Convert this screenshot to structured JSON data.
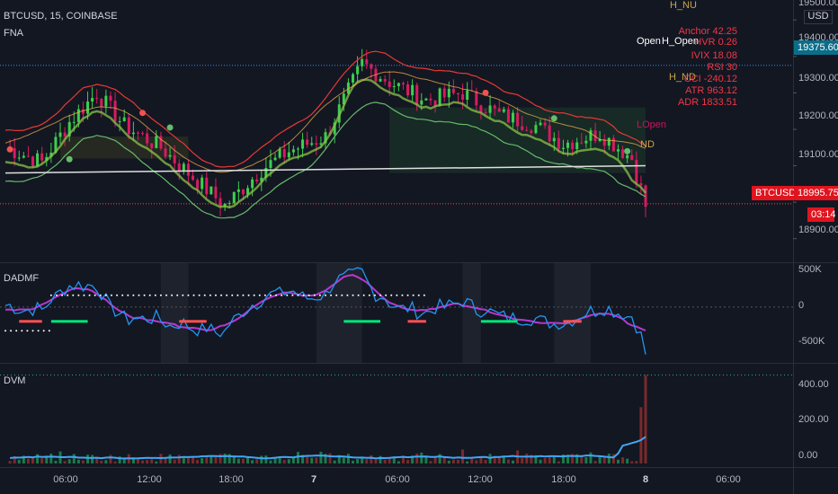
{
  "symbol_title": "BTCUSD, 15, COINBASE",
  "main_indicator": "FNA",
  "currency": "USD",
  "price_axis": [
    "19500.00",
    "19400.00",
    "19300.00",
    "19200.00",
    "19100.00",
    "19000.00",
    "18900.00"
  ],
  "price_tags": {
    "open_price": "19375.60",
    "last_symbol": "BTCUSD",
    "last_price": "18995.75",
    "countdown": "03:14"
  },
  "chart_labels": {
    "h_nu": "H_NU",
    "open": "Open",
    "h_open": "H_Open",
    "h_nd": "H_ND",
    "l_open": "LOpen",
    "nd": "ND"
  },
  "stats": [
    "Anchor 42.25",
    "HVR 0.26",
    "IVIX 18.08",
    "RSI 30",
    "CCI -240.12",
    "ATR 963.12",
    "ADR 1833.51"
  ],
  "dadmf": {
    "title": "DADMF",
    "axis": [
      "500K",
      "0",
      "-500K"
    ]
  },
  "dvm": {
    "title": "DVM",
    "axis": [
      "400.00",
      "200.00",
      "0.00"
    ]
  },
  "time_axis": [
    "06:00",
    "12:00",
    "18:00",
    "7",
    "06:00",
    "12:00",
    "18:00",
    "8",
    "06:00"
  ],
  "colors": {
    "background": "#131722",
    "up": "#26a69a",
    "down": "#ef5350",
    "band_red": "#e53935",
    "band_green": "#66bb6a",
    "dadmf_blue": "#2196f3",
    "dadmf_magenta": "#e040fb"
  },
  "chart_data": {
    "type": "candlestick",
    "title": "BTCUSD, 15, COINBASE",
    "y_range": [
      18850,
      19540
    ],
    "y_ticks": [
      19500,
      19400,
      19300,
      19200,
      19100,
      19000,
      18900
    ],
    "x_ticks": [
      "06:00",
      "12:00",
      "18:00",
      "7",
      "06:00",
      "12:00",
      "18:00",
      "8",
      "06:00"
    ],
    "price_anchor": [
      [
        0,
        19150
      ],
      [
        8,
        19110
      ],
      [
        14,
        19220
      ],
      [
        20,
        19300
      ],
      [
        26,
        19210
      ],
      [
        34,
        19150
      ],
      [
        40,
        19080
      ],
      [
        48,
        18990
      ],
      [
        56,
        19090
      ],
      [
        62,
        19140
      ],
      [
        70,
        19180
      ],
      [
        78,
        19380
      ],
      [
        84,
        19330
      ],
      [
        92,
        19280
      ],
      [
        100,
        19300
      ],
      [
        108,
        19240
      ],
      [
        116,
        19210
      ],
      [
        122,
        19160
      ],
      [
        130,
        19190
      ],
      [
        137,
        19120
      ],
      [
        140,
        18990
      ]
    ],
    "last_price": 18995.75,
    "open_level": 19375.6,
    "white_ma": [
      [
        0,
        19080
      ],
      [
        140,
        19100
      ]
    ],
    "dadmf_range": [
      -650000,
      500000
    ],
    "dvm_range": [
      0,
      460
    ]
  }
}
